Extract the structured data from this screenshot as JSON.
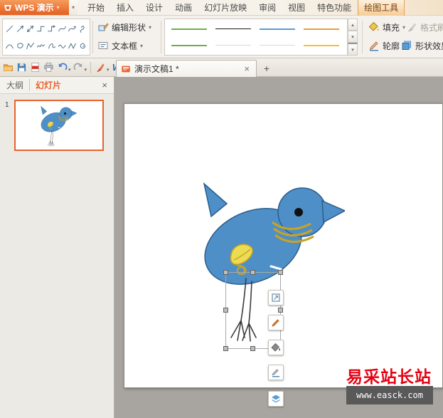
{
  "colors": {
    "wps_orange": "#E8622D",
    "bird_blue": "#4E8FC7",
    "bird_outline": "#2B5E8C",
    "gold": "#C9A227",
    "wing_yellow": "#EBDC52",
    "leg_gray": "#3C3C3C",
    "watermark_red": "#E60012",
    "watermark_bar_bg": "#595959"
  },
  "titlebar": {
    "app_label": "WPS 演示",
    "tabs": [
      "开始",
      "插入",
      "设计",
      "动画",
      "幻灯片放映",
      "审阅",
      "视图",
      "特色功能",
      "绘图工具"
    ]
  },
  "ribbon": {
    "edit_shape": "编辑形状",
    "text_box": "文本框",
    "fill": "填充",
    "format_painter": "格式刷",
    "outline": "轮廓",
    "shape_effects": "形状效果",
    "line_gallery_row1": [
      "#6FAF46",
      "#1A1A1A",
      "#5B9BD5",
      "#ED9B40"
    ],
    "line_gallery_row2": [
      "#6FAF46",
      "#D9D9D9",
      "#D9D9D9",
      "#F2C231"
    ]
  },
  "icons": {
    "close": "×",
    "plus": "+",
    "caret": "▾",
    "caret_up": "▴",
    "wps_w": "W"
  },
  "doc_tab": {
    "title": "演示文稿1 *"
  },
  "sidebar": {
    "tab_outline": "大纲",
    "tab_slides": "幻灯片",
    "slide_number": "1"
  },
  "watermark": {
    "line1": "易采站长站",
    "line2": "www.easck.com"
  }
}
